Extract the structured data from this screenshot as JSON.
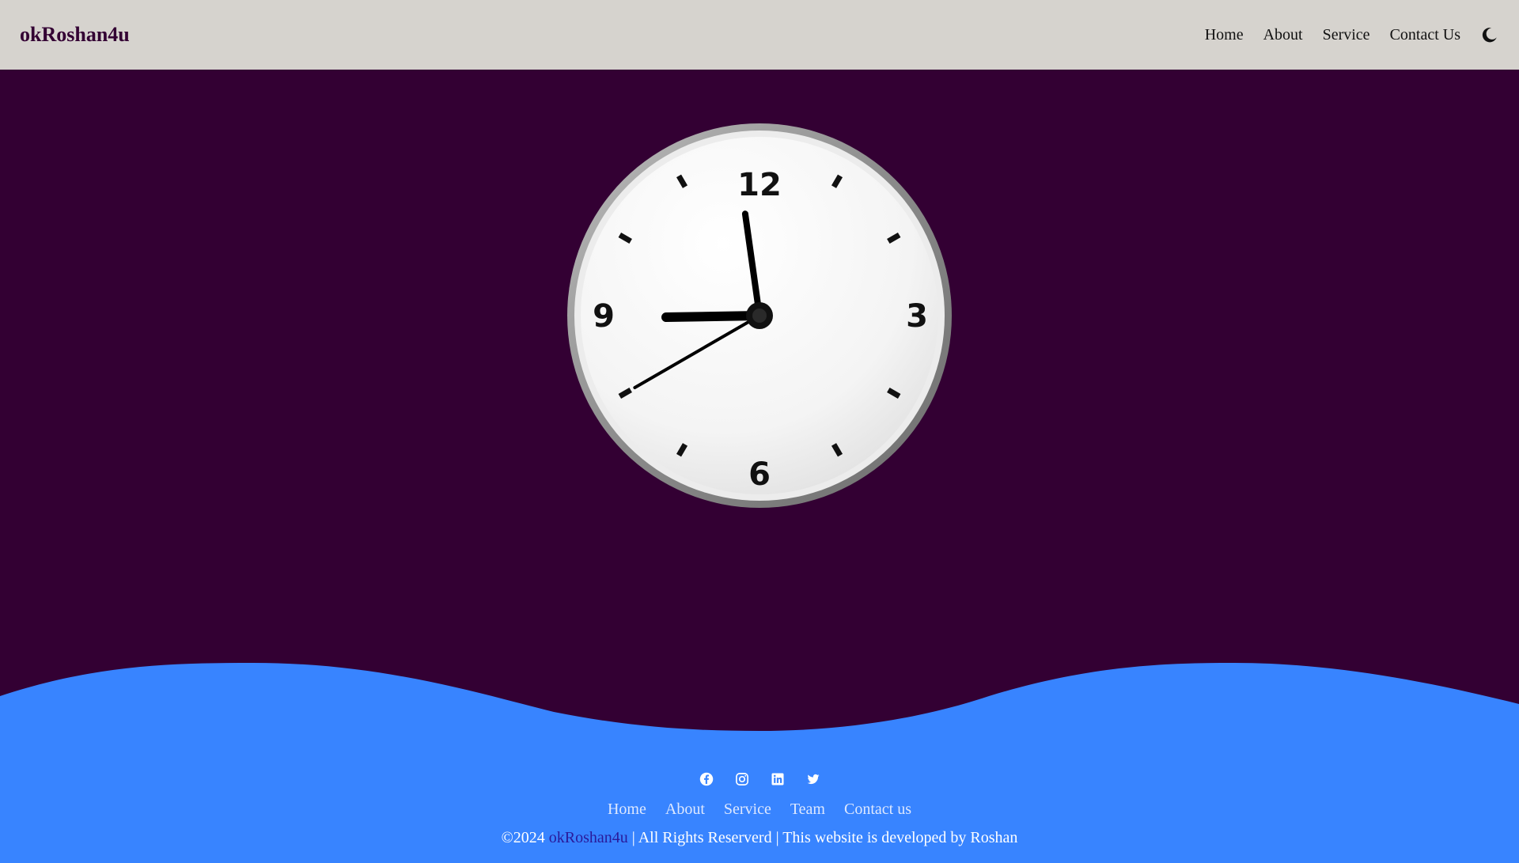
{
  "navbar": {
    "brand": "okRoshan4u",
    "links": [
      "Home",
      "About",
      "Service",
      "Contact Us"
    ],
    "theme_toggle_icon": "moon-icon"
  },
  "clock": {
    "numerals": [
      "12",
      "3",
      "6",
      "9"
    ],
    "time": {
      "hour": 8,
      "minute": 58,
      "second": 40
    }
  },
  "footer": {
    "social_icons": [
      "facebook-icon",
      "instagram-icon",
      "linkedin-icon",
      "twitter-icon"
    ],
    "links": [
      "Home",
      "About",
      "Service",
      "Team",
      "Contact us"
    ],
    "copyright_prefix": "©2024",
    "copyright_brand": "okRoshan4u",
    "copyright_suffix": "| All Rights Reserverd | This website is developed by Roshan"
  },
  "colors": {
    "background": "#330033",
    "navbar": "#d6d3ce",
    "footer": "#3884ff",
    "brand": "#330033"
  }
}
